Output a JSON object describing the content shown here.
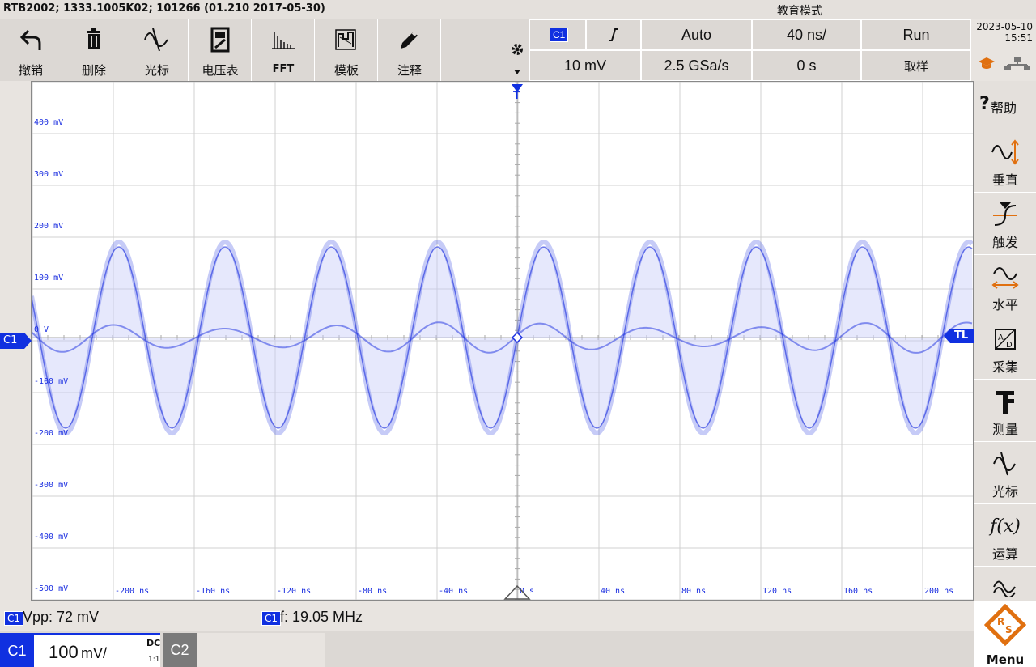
{
  "titlebar": {
    "device_info": "RTB2002; 1333.1005K02; 101266 (01.210 2017-05-30)",
    "mode": "教育模式"
  },
  "toolbar": [
    {
      "label": "撤销",
      "icon": "undo-icon"
    },
    {
      "label": "删除",
      "icon": "trash-icon"
    },
    {
      "label": "光标",
      "icon": "cursor-wave-icon"
    },
    {
      "label": "电压表",
      "icon": "voltmeter-icon"
    },
    {
      "label": "FFT",
      "icon": "fft-icon"
    },
    {
      "label": "模板",
      "icon": "mask-icon"
    },
    {
      "label": "注释",
      "icon": "pencil-icon"
    }
  ],
  "settings": {
    "channel_badge": "C1",
    "trigger_mode": "Auto",
    "timebase": "40 ns/",
    "run_state": "Run",
    "scale": "10 mV",
    "sample_rate": "2.5 GSa/s",
    "position": "0 s",
    "acq_mode": "取样"
  },
  "datetime": {
    "date": "2023-05-10",
    "time": "15:51"
  },
  "sidebar": [
    {
      "label": "帮助",
      "icon": "help-icon"
    },
    {
      "label": "垂直",
      "icon": "vertical-icon"
    },
    {
      "label": "触发",
      "icon": "trigger-icon"
    },
    {
      "label": "水平",
      "icon": "horizontal-icon"
    },
    {
      "label": "采集",
      "icon": "acquire-icon"
    },
    {
      "label": "测量",
      "icon": "measure-icon"
    },
    {
      "label": "光标",
      "icon": "cursor-icon"
    },
    {
      "label": "运算",
      "icon": "math-icon"
    }
  ],
  "menu_label": "Menu",
  "scope": {
    "y_labels": [
      "400 mV",
      "300 mV",
      "200 mV",
      "100 mV",
      "0 V",
      "-100 mV",
      "-200 mV",
      "-300 mV",
      "-400 mV",
      "-500 mV"
    ],
    "x_labels": [
      "-200 ns",
      "-160 ns",
      "-120 ns",
      "-80 ns",
      "-40 ns",
      "0 s",
      "40 ns",
      "80 ns",
      "120 ns",
      "160 ns",
      "200 ns"
    ],
    "channel_marker": "C1",
    "trigger_level_marker": "TL",
    "trigger_marker": "T",
    "colors": {
      "trace": "#1a2ee0",
      "envelope": "#c8ccf8",
      "grid": "#d0d0d0"
    }
  },
  "measurements": {
    "vpp_badge": "C1",
    "vpp": "Vpp: 72 mV",
    "freq_badge": "C1",
    "freq": "f: 19.05 MHz"
  },
  "channels": {
    "c1_label": "C1",
    "c1_scale_num": "100",
    "c1_scale_unit": "mV/",
    "c1_coupling": "DC",
    "c1_probe": "1:1",
    "c2_label": "C2"
  }
}
